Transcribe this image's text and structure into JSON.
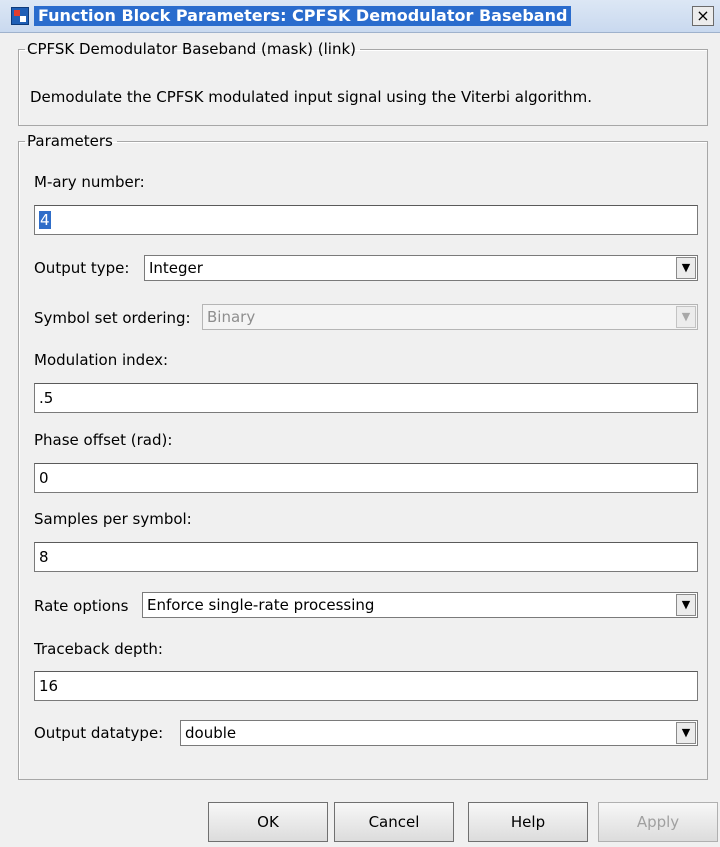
{
  "window": {
    "title": "Function Block Parameters: CPFSK Demodulator Baseband",
    "close_glyph": "×"
  },
  "block": {
    "group_title": "CPFSK Demodulator Baseband (mask) (link)",
    "description": "Demodulate the CPFSK modulated input signal using the Viterbi algorithm."
  },
  "parameters": {
    "group_title": "Parameters",
    "m_ary_label": "M-ary number:",
    "m_ary_value": "4",
    "output_type_label": "Output type:",
    "output_type_value": "Integer",
    "symbol_ordering_label": "Symbol set ordering:",
    "symbol_ordering_value": "Binary",
    "mod_index_label": "Modulation index:",
    "mod_index_value": ".5",
    "phase_offset_label": "Phase offset (rad):",
    "phase_offset_value": "0",
    "samples_label": "Samples per symbol:",
    "samples_value": "8",
    "rate_label": "Rate options",
    "rate_value": "Enforce single-rate processing",
    "traceback_label": "Traceback depth:",
    "traceback_value": "16",
    "datatype_label": "Output datatype:",
    "datatype_value": "double"
  },
  "buttons": {
    "ok": "OK",
    "cancel": "Cancel",
    "help": "Help",
    "apply": "Apply"
  },
  "icons": {
    "dropdown": "chevron-down-icon",
    "app": "simulink-block-icon"
  }
}
